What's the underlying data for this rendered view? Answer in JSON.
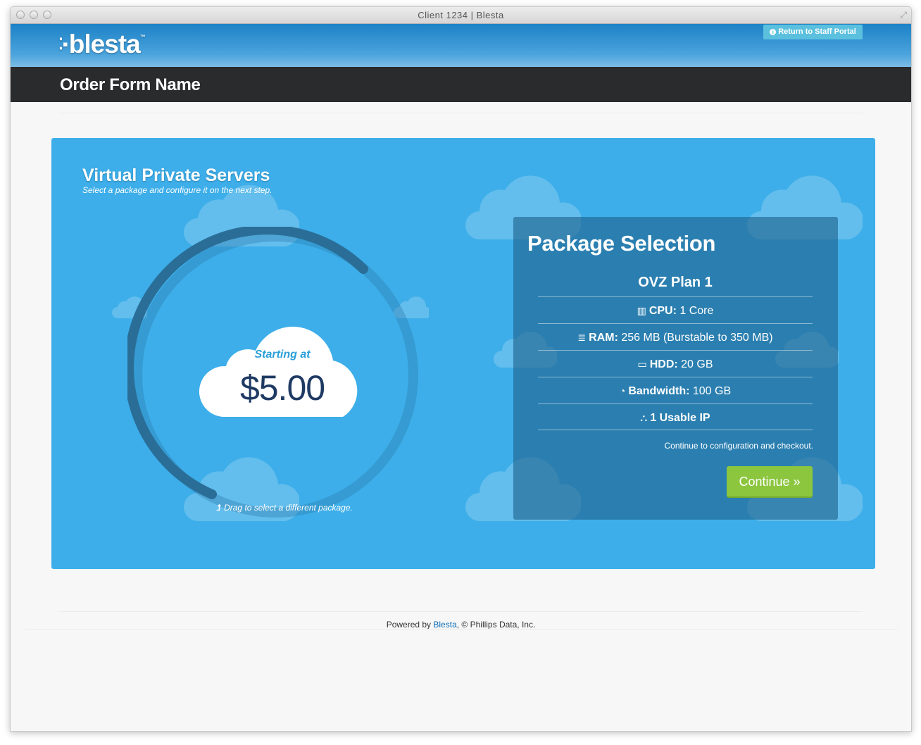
{
  "window": {
    "title": "Client 1234 | Blesta"
  },
  "header": {
    "logo": "blesta",
    "logo_tm": "™",
    "staff_portal_label": "Return to Staff Portal"
  },
  "title_band": {
    "title": "Order Form Name"
  },
  "hero": {
    "title": "Virtual Private Servers",
    "subtitle": "Select a package and configure it on the next step.",
    "starting_label": "Starting at",
    "price": "$5.00",
    "drag_hint": "Drag to select a different package."
  },
  "package_selection": {
    "heading": "Package Selection",
    "plan_name": "OVZ Plan 1",
    "specs": [
      {
        "icon": "bar-chart-icon",
        "label": "CPU:",
        "value": "1 Core"
      },
      {
        "icon": "database-icon",
        "label": "RAM:",
        "value": "256 MB (Burstable to 350 MB)"
      },
      {
        "icon": "hdd-icon",
        "label": "HDD:",
        "value": "20 GB"
      },
      {
        "icon": "dashboard-icon",
        "label": "Bandwidth:",
        "value": "100 GB"
      },
      {
        "icon": "sitemap-icon",
        "label": "1 Usable IP",
        "value": ""
      }
    ],
    "checkout_note": "Continue to configuration and checkout.",
    "continue_label": "Continue »"
  },
  "footer": {
    "prefix": "Powered by ",
    "link": "Blesta",
    "suffix": ", © Phillips Data, Inc."
  },
  "colors": {
    "panel": "#3daee9",
    "continue": "#8cc63f",
    "price": "#1f3a63",
    "title_band": "#2a2b2d"
  }
}
